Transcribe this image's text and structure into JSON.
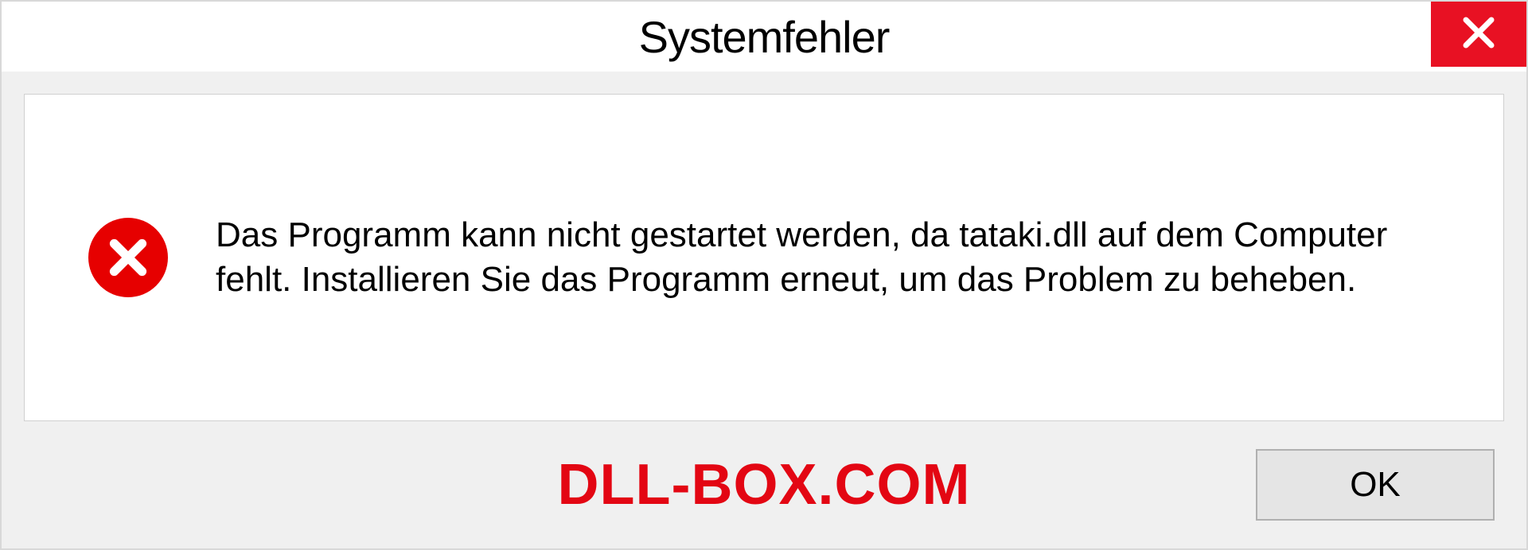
{
  "dialog": {
    "title": "Systemfehler",
    "message": "Das Programm kann nicht gestartet werden, da tataki.dll auf dem Computer fehlt. Installieren Sie das Programm erneut, um das Problem zu beheben.",
    "ok_label": "OK"
  },
  "watermark": {
    "text": "DLL-BOX.COM"
  },
  "colors": {
    "close_button_bg": "#e81123",
    "error_icon_bg": "#e60000",
    "watermark_color": "#e30613"
  }
}
